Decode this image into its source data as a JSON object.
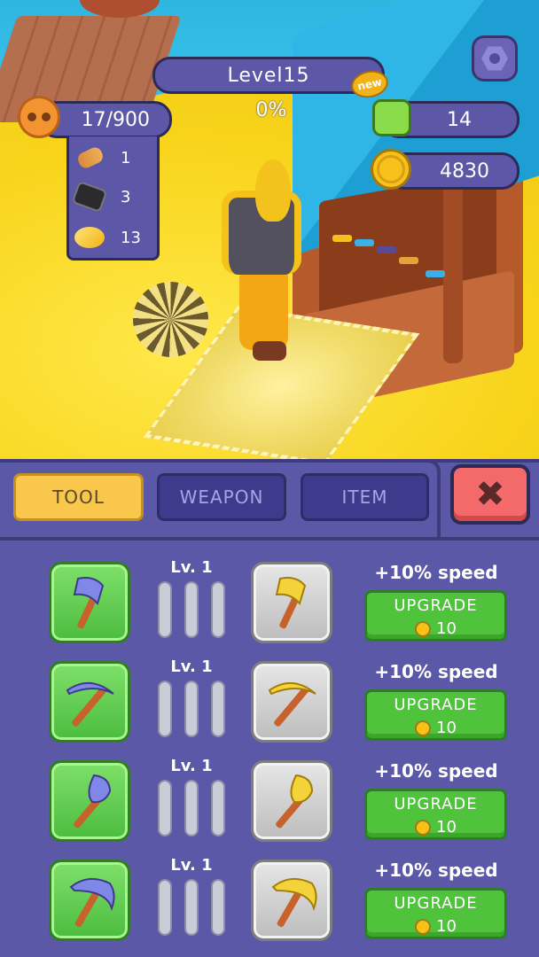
{
  "hud": {
    "level_label": "Level15",
    "new_badge": "new",
    "level_progress": "0%",
    "bag_capacity": "17/900",
    "resources": [
      {
        "name": "wood",
        "value": "1"
      },
      {
        "name": "coal",
        "value": "3"
      },
      {
        "name": "gold-ore",
        "value": "13"
      }
    ],
    "gems": "14",
    "coins": "4830"
  },
  "tabs": [
    {
      "label": "TOOL",
      "selected": true
    },
    {
      "label": "WEAPON",
      "selected": false
    },
    {
      "label": "ITEM",
      "selected": false
    }
  ],
  "close_label": "✖",
  "tools": [
    {
      "icon": "axe-icon",
      "next_icon": "golden-axe-icon",
      "level": "Lv. 1",
      "bonus": "+10% speed",
      "button": "UPGRADE",
      "cost": "10",
      "progress": 0.0
    },
    {
      "icon": "pickaxe-icon",
      "next_icon": "golden-pickaxe-icon",
      "level": "Lv. 1",
      "bonus": "+10% speed",
      "button": "UPGRADE",
      "cost": "10",
      "progress": 0.0
    },
    {
      "icon": "shovel-icon",
      "next_icon": "golden-shovel-icon",
      "level": "Lv. 1",
      "bonus": "+10% speed",
      "button": "UPGRADE",
      "cost": "10",
      "progress": 0.0
    },
    {
      "icon": "scythe-pick-icon",
      "next_icon": "golden-scythe-pick-icon",
      "level": "Lv. 1",
      "bonus": "+10% speed",
      "button": "UPGRADE",
      "cost": "10",
      "progress": 0.0
    }
  ],
  "colors": {
    "panel": "#5b58a7",
    "tab_selected": "#f8c74c",
    "upgrade_green": "#4ec33b",
    "close_red": "#f46a6a"
  }
}
